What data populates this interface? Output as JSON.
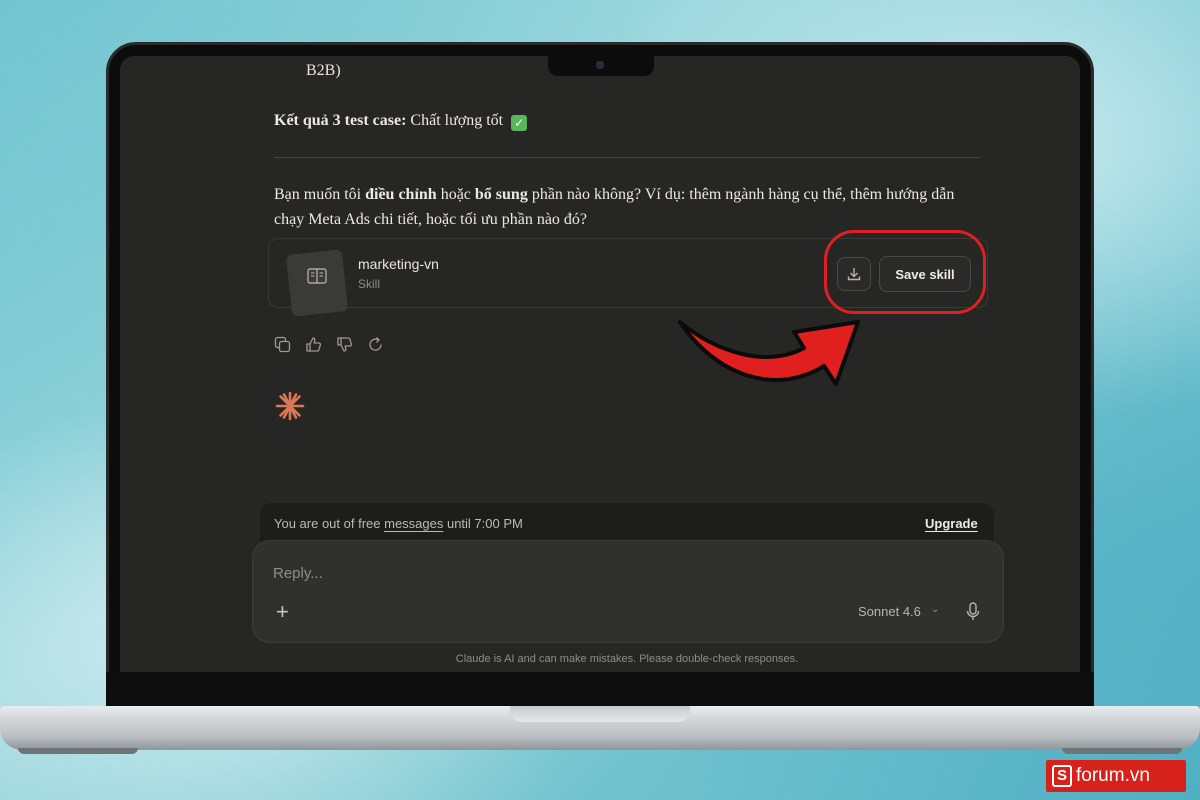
{
  "conversation": {
    "fragment_text": "B2B)",
    "result_label": "Kết quả 3 test case:",
    "result_value": "Chất lượng tốt",
    "question_part1": "Bạn muốn tôi ",
    "question_bold1": "điều chỉnh",
    "question_part2": " hoặc ",
    "question_bold2": "bổ sung",
    "question_part3": " phần nào không? Ví dụ: thêm ngành hàng cụ thể, thêm hướng dẫn chạy Meta Ads chi tiết, hoặc tối ưu phần nào đó?"
  },
  "skill_card": {
    "name": "marketing-vn",
    "type": "Skill",
    "save_label": "Save skill",
    "download_icon": "download-icon"
  },
  "message_actions": [
    "copy-icon",
    "thumbs-up-icon",
    "thumbs-down-icon",
    "retry-icon"
  ],
  "notice": {
    "text_before": "You are out of free ",
    "link": "messages",
    "text_after": " until 7:00 PM",
    "upgrade_label": "Upgrade"
  },
  "composer": {
    "placeholder": "Reply...",
    "model": "Sonnet 4.6",
    "add_icon": "plus-icon",
    "mic_icon": "microphone-icon"
  },
  "disclaimer": "Claude is AI and can make mistakes. Please double-check responses.",
  "watermark": {
    "letter": "S",
    "text": "forum.vn"
  },
  "colors": {
    "accent_red": "#e0201f",
    "brand_orange": "#d97757",
    "screen_bg": "#262624"
  }
}
